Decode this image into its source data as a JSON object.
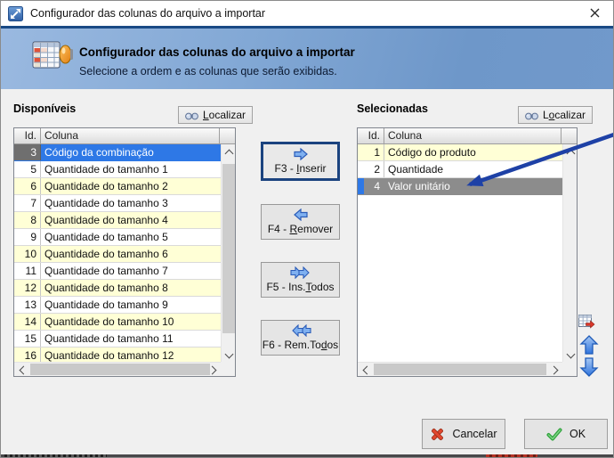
{
  "window": {
    "title": "Configurador das colunas do arquivo a importar"
  },
  "header": {
    "title": "Configurador das colunas do arquivo a importar",
    "subtitle": "Selecione a ordem e as colunas que serão exibidas."
  },
  "available": {
    "label": "Disponíveis",
    "find_button": {
      "pre": "",
      "accel": "L",
      "post": "ocalizar"
    },
    "columns": {
      "id": "Id.",
      "name": "Coluna"
    },
    "selected_id": 3,
    "rows": [
      {
        "id": 3,
        "name": "Código da combinação",
        "selected": true
      },
      {
        "id": 5,
        "name": "Quantidade do tamanho 1"
      },
      {
        "id": 6,
        "name": "Quantidade do tamanho 2"
      },
      {
        "id": 7,
        "name": "Quantidade do tamanho 3"
      },
      {
        "id": 8,
        "name": "Quantidade do tamanho 4"
      },
      {
        "id": 9,
        "name": "Quantidade do tamanho 5"
      },
      {
        "id": 10,
        "name": "Quantidade do tamanho 6"
      },
      {
        "id": 11,
        "name": "Quantidade do tamanho 7"
      },
      {
        "id": 12,
        "name": "Quantidade do tamanho 8"
      },
      {
        "id": 13,
        "name": "Quantidade do tamanho 9"
      },
      {
        "id": 14,
        "name": "Quantidade do tamanho 10"
      },
      {
        "id": 15,
        "name": "Quantidade do tamanho 11"
      },
      {
        "id": 16,
        "name": "Quantidade do tamanho 12"
      }
    ]
  },
  "selected": {
    "label": "Selecionadas",
    "find_button": {
      "pre": "L",
      "accel": "o",
      "post": "calizar"
    },
    "columns": {
      "id": "Id.",
      "name": "Coluna"
    },
    "selected_id": 4,
    "rows": [
      {
        "id": 1,
        "name": "Código do produto"
      },
      {
        "id": 2,
        "name": "Quantidade"
      },
      {
        "id": 4,
        "name": "Valor unitário",
        "selected": true
      }
    ]
  },
  "actions": {
    "insert": {
      "pre": "F3 - ",
      "accel": "I",
      "post": "nserir"
    },
    "remove": {
      "pre": "F4 - ",
      "accel": "R",
      "post": "emover"
    },
    "insert_all": {
      "pre": "F5 - Ins.",
      "accel": "T",
      "post": "odos"
    },
    "remove_all": {
      "pre": "F6 - Rem.To",
      "accel": "d",
      "post": "os"
    }
  },
  "footer": {
    "cancel": "Cancelar",
    "ok": "OK"
  },
  "icons": {
    "titlebar": "app-icon",
    "close": "close-x",
    "find": "binoculars",
    "insert": "blue-arrow-right",
    "remove": "blue-arrow-left",
    "insert_all": "blue-double-arrow-right",
    "remove_all": "blue-double-arrow-left",
    "move_up": "blue-arrow-up",
    "move_down": "blue-arrow-down",
    "grid_action": "table-red-arrow",
    "cancel": "red-x",
    "ok": "green-check",
    "annotation": "blue-pointer-arrow"
  },
  "colors": {
    "selection_blue": "#2e78e6",
    "selection_gray": "#8c8c8c",
    "selected_id_cell": "#6f6f6f",
    "stripe_yellow": "#ffffd6",
    "header_gradient_top": "#9ab9e0",
    "header_border": "#1a4a85",
    "annotation_arrow": "#1e41a6",
    "cancel_icon": "#e2472e",
    "ok_icon": "#2fa33c",
    "focus_border": "#1b437f"
  }
}
